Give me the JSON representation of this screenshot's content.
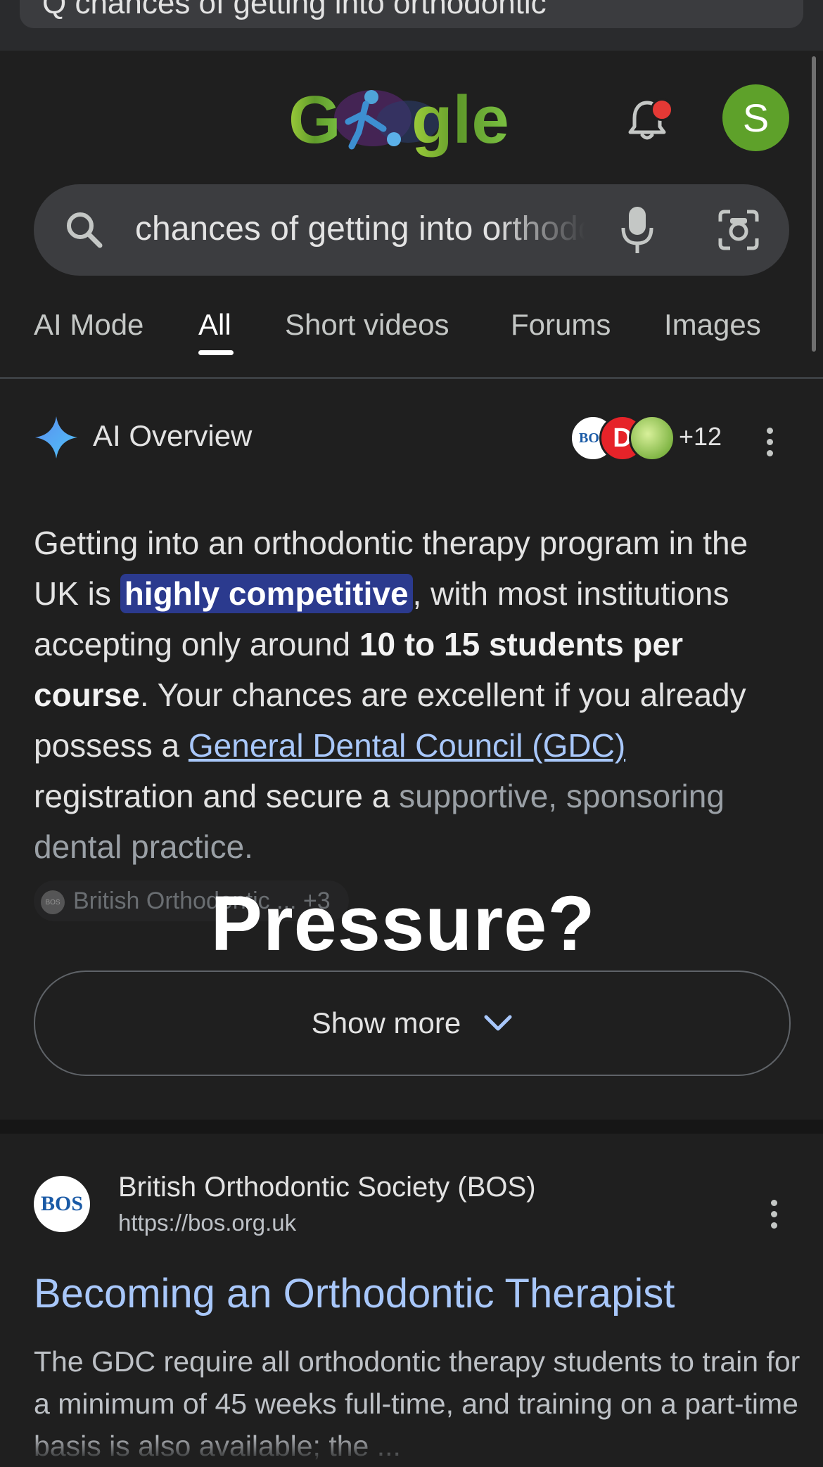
{
  "browser": {
    "url_text": "Q chances of getting into orthodontic"
  },
  "header": {
    "logo_alt": "Google",
    "avatar_initial": "S"
  },
  "search": {
    "query": "chances of getting into orthodontic therapy"
  },
  "tabs": [
    {
      "label": "AI Mode"
    },
    {
      "label": "All",
      "active": true
    },
    {
      "label": "Short videos"
    },
    {
      "label": "Forums"
    },
    {
      "label": "Images"
    }
  ],
  "ai_overview": {
    "title": "AI Overview",
    "source_count": "+12",
    "source_bos": "BOS",
    "source_d": "D",
    "para": {
      "p1": "Getting into an orthodontic therapy program in the UK is ",
      "highlight": "highly competitive",
      "p2": ", with most institutions accepting only around ",
      "bold": "10 to 15 students per course",
      "p3": ". Your chances are excellent if you already possess a ",
      "link": "General Dental Council (GDC)",
      "p4": " registration and secure a ",
      "fade": "supportive, sponsoring dental practice."
    },
    "chip_text": "British Orthodontic ... +3",
    "overlay": "Pressure?",
    "show_more": "Show more"
  },
  "result": {
    "favicon_text": "BOS",
    "site_name": "British Orthodontic Society (BOS)",
    "url": "https://bos.org.uk",
    "title": "Becoming an Orthodontic Therapist",
    "snippet": "The GDC require all orthodontic therapy students to train for a minimum of 45 weeks full-time, and training on a part-time basis is also available; the ..."
  },
  "colors": {
    "background": "#1f1f1f",
    "link": "#a8c7fa",
    "highlight": "#2b3a8e",
    "avatar": "#5ea12a",
    "notification_dot": "#e53935"
  }
}
